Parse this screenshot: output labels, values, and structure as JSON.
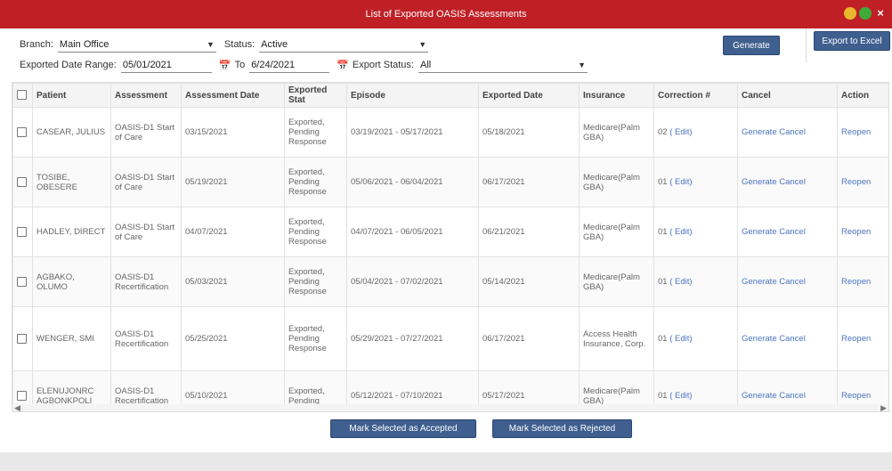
{
  "window": {
    "title": "List of Exported OASIS Assessments",
    "close_glyph": "×"
  },
  "filters": {
    "branch_label": "Branch:",
    "branch_value": "Main Office",
    "status_label": "Status:",
    "status_value": "Active",
    "date_range_label": "Exported Date Range:",
    "from_date": "05/01/2021",
    "to_label": "To",
    "to_date": "6/24/2021",
    "export_status_label": "Export Status:",
    "export_status_value": "All"
  },
  "buttons": {
    "generate": "Generate",
    "export_excel": "Export to Excel",
    "mark_accepted": "Mark Selected as Accepted",
    "mark_rejected": "Mark Selected as Rejected"
  },
  "table": {
    "headers": {
      "patient": "Patient",
      "assessment": "Assessment",
      "assessment_date": "Assessment Date",
      "exported_status": "Exported Stat",
      "episode": "Episode",
      "exported_date": "Exported Date",
      "insurance": "Insurance",
      "correction": "Correction #",
      "cancel": "Cancel",
      "action": "Action"
    },
    "rows": [
      {
        "patient": "CASEAR, JULIUS",
        "assessment": "OASIS-D1 Start of Care",
        "assessment_date": "03/15/2021",
        "status": "Exported, Pending Response",
        "episode": "03/19/2021 - 05/17/2021",
        "exported_date": "05/18/2021",
        "insurance": "Medicare(Palm GBA)",
        "correction": "02",
        "edit": "( Edit)",
        "cancel": "Generate Cancel",
        "action": "Reopen"
      },
      {
        "patient": "TOSIBE, OBESERE",
        "assessment": "OASIS-D1 Start of Care",
        "assessment_date": "05/19/2021",
        "status": "Exported, Pending Response",
        "episode": "05/06/2021 - 06/04/2021",
        "exported_date": "06/17/2021",
        "insurance": "Medicare(Palm GBA)",
        "correction": "01",
        "edit": "( Edit)",
        "cancel": "Generate Cancel",
        "action": "Reopen"
      },
      {
        "patient": "HADLEY, DIRECT",
        "assessment": "OASIS-D1 Start of Care",
        "assessment_date": "04/07/2021",
        "status": "Exported, Pending Response",
        "episode": "04/07/2021 - 06/05/2021",
        "exported_date": "06/21/2021",
        "insurance": "Medicare(Palm GBA)",
        "correction": "01",
        "edit": "( Edit)",
        "cancel": "Generate Cancel",
        "action": "Reopen"
      },
      {
        "patient": "AGBAKO, OLUMO",
        "assessment": "OASIS-D1 Recertification",
        "assessment_date": "05/03/2021",
        "status": "Exported, Pending Response",
        "episode": "05/04/2021 - 07/02/2021",
        "exported_date": "05/14/2021",
        "insurance": "Medicare(Palm GBA)",
        "correction": "01",
        "edit": "( Edit)",
        "cancel": "Generate Cancel",
        "action": "Reopen"
      },
      {
        "patient": "WENGER, SMI",
        "assessment": "OASIS-D1 Recertification",
        "assessment_date": "05/25/2021",
        "status": "Exported, Pending Response",
        "episode": "05/29/2021 - 07/27/2021",
        "exported_date": "06/17/2021",
        "insurance": "Access Health Insurance, Corp.",
        "correction": "01",
        "edit": "( Edit)",
        "cancel": "Generate Cancel",
        "action": "Reopen"
      },
      {
        "patient": "ELENUJONRC AGBONKPOLI",
        "assessment": "OASIS-D1 Recertification",
        "assessment_date": "05/10/2021",
        "status": "Exported, Pending",
        "episode": "05/12/2021 - 07/10/2021",
        "exported_date": "05/17/2021",
        "insurance": "Medicare(Palm GBA)",
        "correction": "01",
        "edit": "( Edit)",
        "cancel": "Generate Cancel",
        "action": "Reopen"
      }
    ]
  },
  "icons": {
    "calendar": "calendar-icon",
    "dropdown": "chevron-down-icon"
  },
  "colors": {
    "title_bar": "#bf2026",
    "button": "#3f5f8f",
    "link": "#4a74c0",
    "minimize": "#e9b82c",
    "maximize": "#3fab3a"
  }
}
